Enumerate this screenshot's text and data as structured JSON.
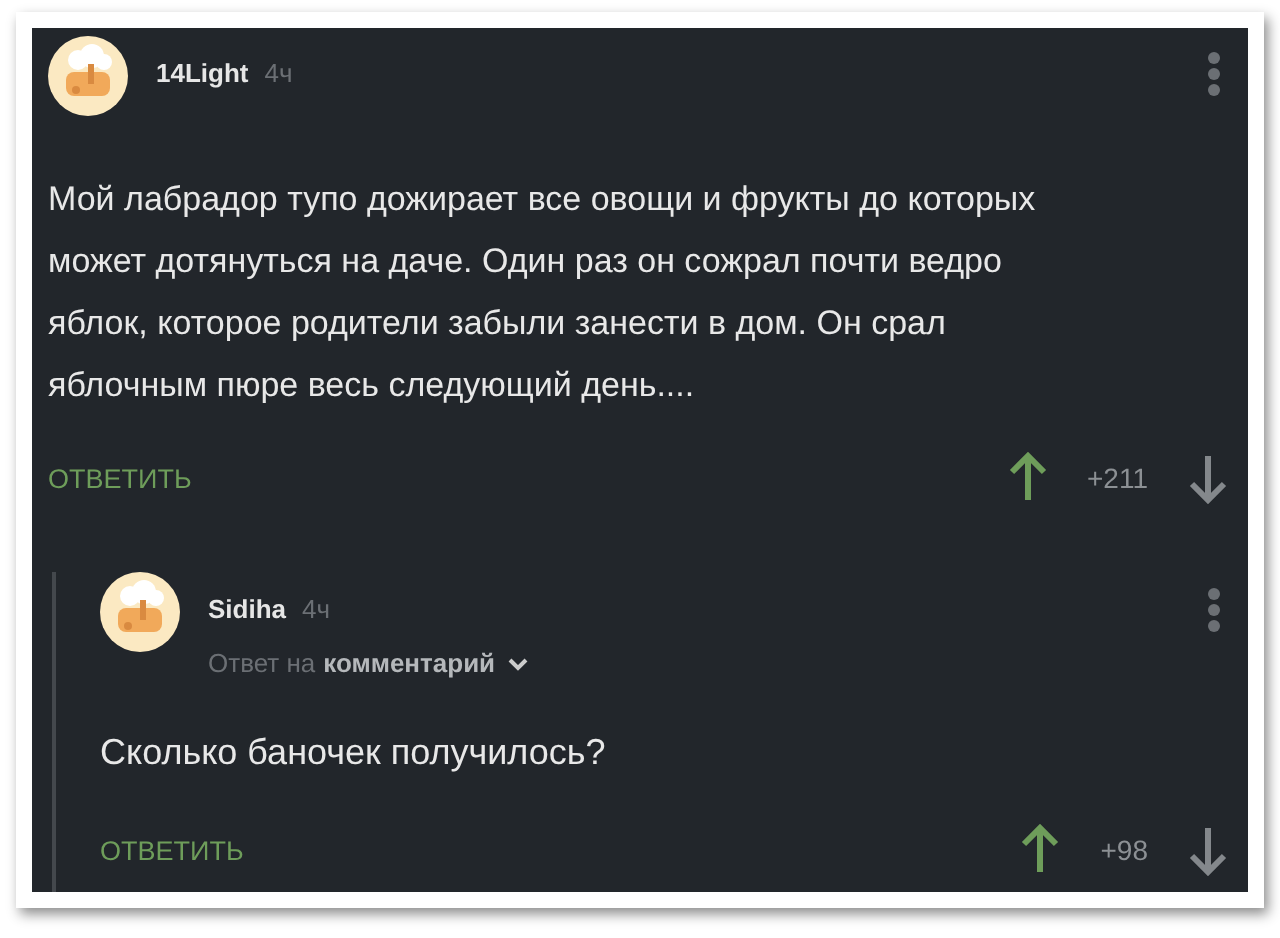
{
  "comments": [
    {
      "author": "14Light",
      "time": "4ч",
      "text": "Мой лабрадор тупо дожирает все овощи и фрукты до которых может дотянуться на даче. Один раз он сожрал почти ведро яблок, которое родители забыли занести в дом. Он срал яблочным пюре весь следующий день....",
      "reply_button": "ОТВЕТИТЬ",
      "rating": "+211",
      "nested": false
    },
    {
      "author": "Sidiha",
      "time": "4ч",
      "reply_to_prefix": "Ответ на",
      "reply_to_link": "комментарий",
      "text": "Сколько баночек получилось?",
      "reply_button": "ОТВЕТИТЬ",
      "rating": "+98",
      "nested": true
    }
  ]
}
